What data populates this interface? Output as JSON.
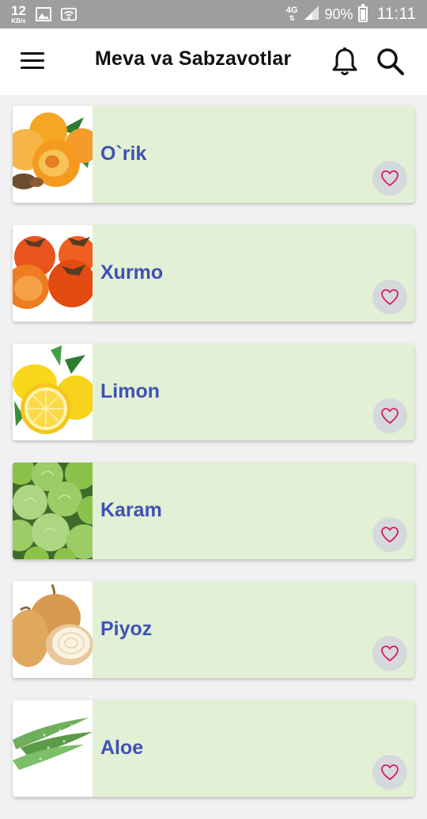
{
  "status_bar": {
    "speed_value": "12",
    "speed_unit": "KB/s",
    "network": "4G",
    "battery": "90%",
    "battery_level": 0.9,
    "time": "11:11"
  },
  "app_bar": {
    "title": "Meva va Sabzavotlar",
    "icons": [
      "menu-icon",
      "bell-icon",
      "search-icon"
    ]
  },
  "items": [
    {
      "name": "O`rik",
      "image": "apricot"
    },
    {
      "name": "Xurmo",
      "image": "persimmon"
    },
    {
      "name": "Limon",
      "image": "lemon"
    },
    {
      "name": "Karam",
      "image": "cabbage"
    },
    {
      "name": "Piyoz",
      "image": "onion"
    },
    {
      "name": "Aloe",
      "image": "aloe"
    }
  ],
  "colors": {
    "card_background": "#e2f0d5",
    "title_color": "#3f51b5",
    "favorite_icon": "#d81b60",
    "status_bar": "#9e9e9e"
  }
}
